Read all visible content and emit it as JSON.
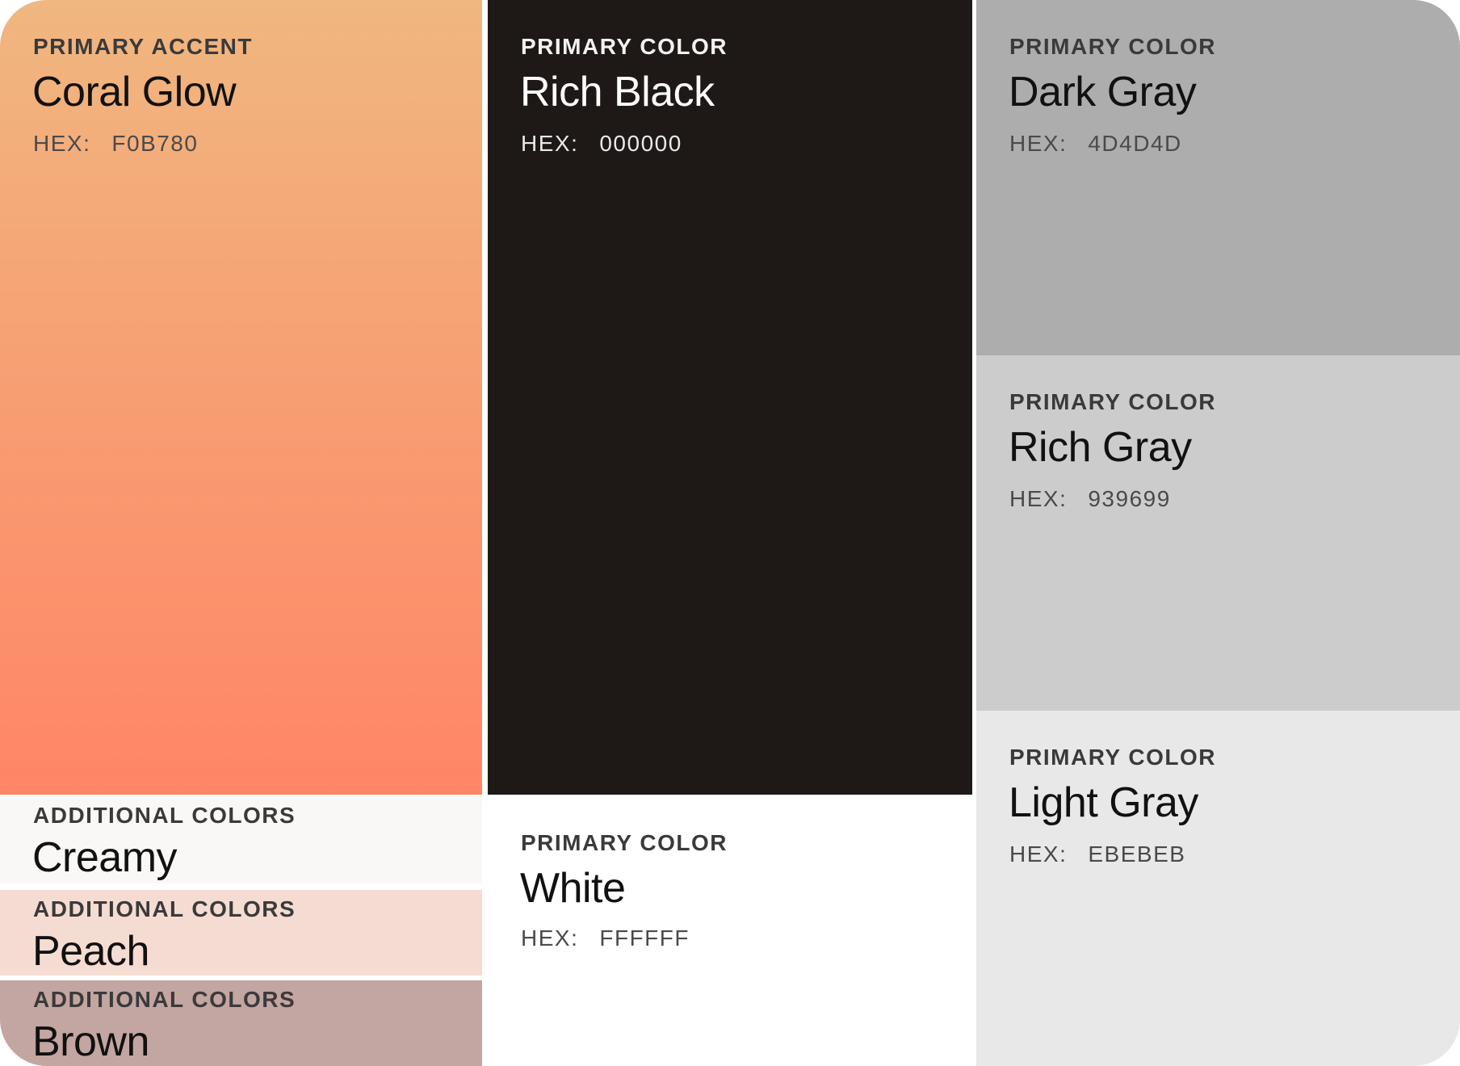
{
  "swatches": {
    "coral_glow": {
      "category": "PRIMARY ACCENT",
      "name": "Coral Glow",
      "hex_label": "HEX:",
      "hex_value": "F0B780",
      "color_top": "#F0B780",
      "color_bottom": "#FF8566"
    },
    "creamy": {
      "category": "ADDITIONAL COLORS",
      "name": "Creamy",
      "color": "#F9F8F6"
    },
    "peach": {
      "category": "ADDITIONAL COLORS",
      "name": "Peach",
      "color": "#F5DCD2"
    },
    "brown": {
      "category": "ADDITIONAL COLORS",
      "name": "Brown",
      "color": "#C3A5A1"
    },
    "rich_black": {
      "category": "PRIMARY COLOR",
      "name": "Rich Black",
      "hex_label": "HEX:",
      "hex_value": "000000",
      "color": "#1E1917"
    },
    "white": {
      "category": "PRIMARY COLOR",
      "name": "White",
      "hex_label": "HEX:",
      "hex_value": "FFFFFF",
      "color": "#FFFFFF"
    },
    "dark_gray": {
      "category": "PRIMARY COLOR",
      "name": "Dark Gray",
      "hex_label": "HEX:",
      "hex_value": "4D4D4D",
      "color": "#ADADAD"
    },
    "rich_gray": {
      "category": "PRIMARY COLOR",
      "name": "Rich Gray",
      "hex_label": "HEX:",
      "hex_value": "939699",
      "color": "#CCCCCC"
    },
    "light_gray": {
      "category": "PRIMARY COLOR",
      "name": "Light Gray",
      "hex_label": "HEX:",
      "hex_value": "EBEBEB",
      "color": "#E8E8E8"
    }
  }
}
